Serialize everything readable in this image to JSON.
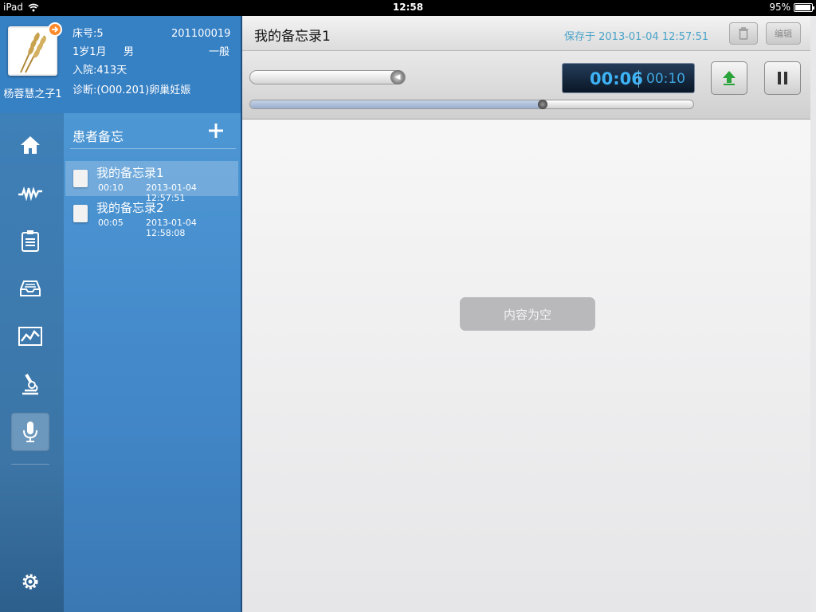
{
  "status_bar": {
    "device": "iPad",
    "time": "12:58",
    "battery": "95%"
  },
  "patient": {
    "name": "杨蓉慧之子1",
    "bed_label": "床号:5",
    "id": "201100019",
    "age": "1岁1月",
    "gender": "男",
    "level": "一般",
    "admitted": "入院:413天",
    "diagnosis": "诊断:(O00.201)卵巢妊娠"
  },
  "nav": {
    "items": [
      "home-icon",
      "waveform-icon",
      "clipboard-icon",
      "tray-icon",
      "chart-icon",
      "microscope-icon",
      "microphone-icon"
    ],
    "active": "microphone-icon",
    "bottom": "gear-icon"
  },
  "memo_list": {
    "header": "患者备忘",
    "items": [
      {
        "title": "我的备忘录1",
        "duration": "00:10",
        "date": "2013-01-04 12:57:51",
        "selected": true
      },
      {
        "title": "我的备忘录2",
        "duration": "00:05",
        "date": "2013-01-04 12:58:08",
        "selected": false
      }
    ]
  },
  "detail": {
    "title": "我的备忘录1",
    "saved": "保存于 2013-01-04 12:57:51",
    "edit_label": "编辑",
    "empty_text": "内容为空"
  },
  "player": {
    "current": "00:06",
    "total": "00:10",
    "progress": 0.66,
    "volume": 1.0
  },
  "colors": {
    "sidebar_blue": "#4287c8",
    "accent_blue": "#3db3f5",
    "upload_green": "#2aa33a"
  }
}
